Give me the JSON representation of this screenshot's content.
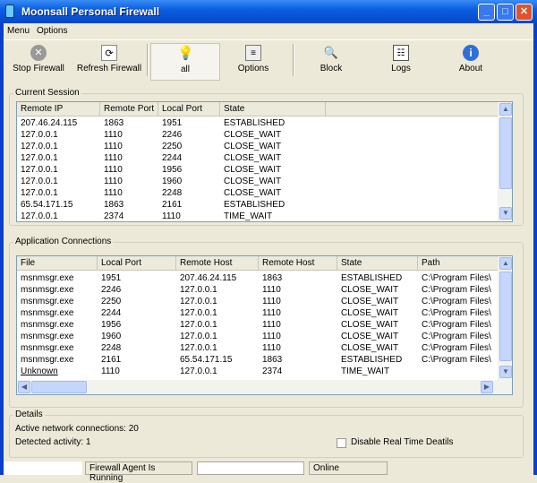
{
  "window": {
    "title": "Moonsall Personal Firewall",
    "minimize": "_",
    "maximize": "□",
    "close": "✕"
  },
  "menu": [
    "Menu",
    "Options"
  ],
  "toolbar": [
    {
      "label": "Stop Firewall",
      "icon": "stop-icon"
    },
    {
      "label": "Refresh Firewall",
      "icon": "refresh-icon"
    },
    {
      "label": "all",
      "icon": "lightbulb-icon",
      "pressed": true
    },
    {
      "label": "Options",
      "icon": "options-icon"
    },
    {
      "label": "Block",
      "icon": "block-icon"
    },
    {
      "label": "Logs",
      "icon": "logs-icon"
    },
    {
      "label": "About",
      "icon": "info-icon"
    }
  ],
  "current_session": {
    "title": "Current Session",
    "columns": [
      "Remote IP",
      "Remote Port",
      "Local Port",
      "State",
      ""
    ],
    "rows": [
      [
        "207.46.24.115",
        "1863",
        "1951",
        "ESTABLISHED"
      ],
      [
        "127.0.0.1",
        "1110",
        "2246",
        "CLOSE_WAIT"
      ],
      [
        "127.0.0.1",
        "1110",
        "2250",
        "CLOSE_WAIT"
      ],
      [
        "127.0.0.1",
        "1110",
        "2244",
        "CLOSE_WAIT"
      ],
      [
        "127.0.0.1",
        "1110",
        "1956",
        "CLOSE_WAIT"
      ],
      [
        "127.0.0.1",
        "1110",
        "1960",
        "CLOSE_WAIT"
      ],
      [
        "127.0.0.1",
        "1110",
        "2248",
        "CLOSE_WAIT"
      ],
      [
        "65.54.171.15",
        "1863",
        "2161",
        "ESTABLISHED"
      ],
      [
        "127.0.0.1",
        "2374",
        "1110",
        "TIME_WAIT"
      ]
    ]
  },
  "app_connections": {
    "title": "Application Connections",
    "columns": [
      "File",
      "Local Port",
      "Remote Host",
      "Remote Host",
      "State",
      "Path"
    ],
    "rows": [
      [
        "msnmsgr.exe",
        "1951",
        "207.46.24.115",
        "1863",
        "ESTABLISHED",
        "C:\\Program Files\\"
      ],
      [
        "msnmsgr.exe",
        "2246",
        "127.0.0.1",
        "1110",
        "CLOSE_WAIT",
        "C:\\Program Files\\"
      ],
      [
        "msnmsgr.exe",
        "2250",
        "127.0.0.1",
        "1110",
        "CLOSE_WAIT",
        "C:\\Program Files\\"
      ],
      [
        "msnmsgr.exe",
        "2244",
        "127.0.0.1",
        "1110",
        "CLOSE_WAIT",
        "C:\\Program Files\\"
      ],
      [
        "msnmsgr.exe",
        "1956",
        "127.0.0.1",
        "1110",
        "CLOSE_WAIT",
        "C:\\Program Files\\"
      ],
      [
        "msnmsgr.exe",
        "1960",
        "127.0.0.1",
        "1110",
        "CLOSE_WAIT",
        "C:\\Program Files\\"
      ],
      [
        "msnmsgr.exe",
        "2248",
        "127.0.0.1",
        "1110",
        "CLOSE_WAIT",
        "C:\\Program Files\\"
      ],
      [
        "msnmsgr.exe",
        "2161",
        "65.54.171.15",
        "1863",
        "ESTABLISHED",
        "C:\\Program Files\\"
      ],
      [
        "Unknown",
        "1110",
        "127.0.0.1",
        "2374",
        "TIME_WAIT",
        ""
      ]
    ]
  },
  "details": {
    "title": "Details",
    "active_connections": "Active network connections: 20",
    "detected_activity": "Detected activity: 1",
    "disable_checkbox": "Disable Real Time Deatils",
    "disable_checked": false
  },
  "statusbar": {
    "agent": "Firewall Agent Is Running",
    "online": "Online"
  }
}
